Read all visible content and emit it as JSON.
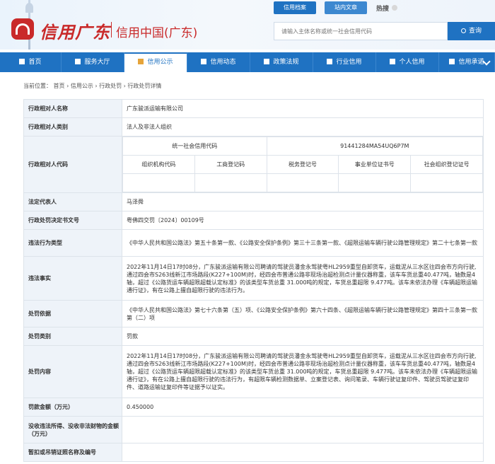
{
  "brand": {
    "logo_text": "信用广东",
    "site_title": "信用中国(广东)",
    "brand_color": "#c92a2a"
  },
  "search": {
    "tabs": [
      "信用档案",
      "站内文章"
    ],
    "hot_label": "热搜",
    "placeholder": "请输入主体名称或统一社会信用代码",
    "button": "查询"
  },
  "nav": {
    "items": [
      {
        "label": "首页",
        "icon": "home-icon"
      },
      {
        "label": "服务大厅",
        "icon": "grid-icon"
      },
      {
        "label": "信用公示",
        "icon": "document-icon",
        "active": true
      },
      {
        "label": "信用动态",
        "icon": "monitor-icon"
      },
      {
        "label": "政策法规",
        "icon": "book-icon"
      },
      {
        "label": "行业信用",
        "icon": "building-icon"
      },
      {
        "label": "个人信用",
        "icon": "person-icon"
      },
      {
        "label": "信用承诺",
        "icon": "shield-icon"
      }
    ],
    "accent": "#1f72c2"
  },
  "breadcrumb": "当前位置： 首页 › 信用公示 › 行政处罚 › 行政处罚详情",
  "detail": {
    "labels": {
      "name": "行政相对人名称",
      "category": "行政相对人类别",
      "code": "行政相对人代码",
      "legal_rep": "法定代表人",
      "doc_no": "行政处罚决定书文号",
      "violation_type": "违法行为类型",
      "facts": "违法事实",
      "basis": "处罚依据",
      "penalty_type": "处罚类别",
      "content": "处罚内容",
      "fine": "罚款金额（万元）",
      "confiscated": "没收违法所得、没收非法财物的金额（万元）",
      "license": "暂扣或吊销证照名称及编号"
    },
    "values": {
      "name": "广东骏派运输有限公司",
      "category": "法人及非法人组织",
      "legal_rep": "马泽舜",
      "doc_no": "粤佛四交罚〔2024〕00109号",
      "violation_type": "《中华人民共和国公路法》第五十条第一款、《公路安全保护条例》第三十三条第一款、《超限运输车辆行驶公路管理规定》第二十七条第一款",
      "facts": "2022年11月14日17时08分，广东骏派运输有限公司聘请的驾驶员潘金永驾驶粤HL2959重型自卸货车，运载泥从三水区往四会市方向行驶,通过四会市S263线新江市场路段(K227+100M)时，经四会市普通公路非现场治超检测点计量仪器称重，该车车货总重40.477吨，轴数是4轴，超过《公路货运车辆超限超载认定标准》的该类型车货总重 31.000吨的规定，车货总重超限 9.477吨。该车未依法办理《车辆超限运输通行证》，有在公路上擅自超限行驶的违法行为。",
      "basis": "《中华人民共和国公路法》第七十六条第（五）项、《公路安全保护条例》第六十四条、《超限运输车辆行驶公路管理规定》第四十三条第一款第（二）项",
      "penalty_type": "罚款",
      "content": "2022年11月14日17时08分，广东骏派运输有限公司聘请的驾驶员潘金永驾驶粤HL2959重型自卸货车，运载泥从三水区往四会市方向行驶,通过四会市S263线新江市场路段(K227+100M)时，经四会市普通公路非现场治超检测点计量仪器称重，该车车货总重40.477吨，轴数是4轴，超过《公路货运车辆超限超载认定标准》的该类型车货总重 31.000吨的规定，车货总重超限 9.477吨。该车未依法办理《车辆超限运输通行证》，有在公路上擅自超限行驶的违法行为，有超限车辆检测数据单、立案登记表、询问笔录、车辆行驶证复印件、驾驶员驾驶证复印件、道路运输证复印件等证据予以证实。",
      "fine": "0.450000",
      "confiscated": "",
      "license": ""
    },
    "codes": {
      "uscc_label": "统一社会信用代码",
      "uscc_value": "91441284MA54UQ6P7M",
      "headers": [
        "组织机构代码",
        "工商登记码",
        "税务登记号",
        "事业单位证书号",
        "社会组织登记证号"
      ],
      "values": [
        "",
        "",
        "",
        "",
        ""
      ]
    }
  }
}
